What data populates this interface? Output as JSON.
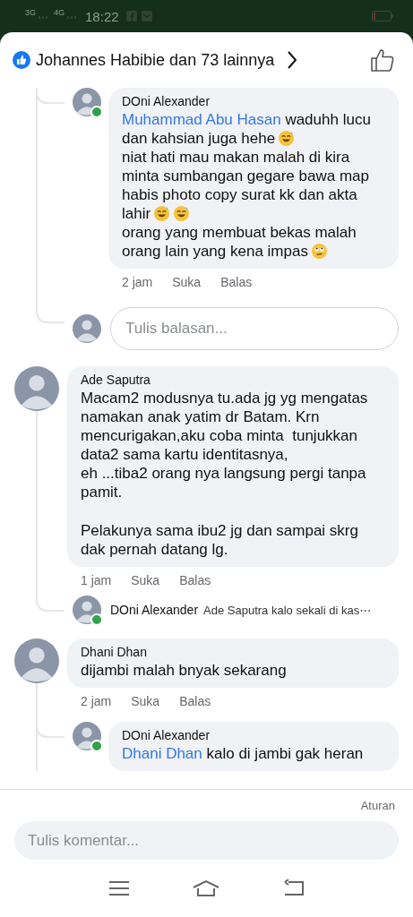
{
  "status_bar": {
    "network_1": "3G",
    "network_2": "4G",
    "time": "18:22"
  },
  "header": {
    "reactions": "Johannes Habibie dan 73 lainnya"
  },
  "comments": [
    {
      "kind": "reply",
      "author": "DOni Alexander",
      "online": true,
      "paragraphs": [
        [
          {
            "mention": "Muhammad Abu Hasan",
            "text": " waduhh lucu"
          },
          {
            "text": "dan kahsian juga hehe",
            "emoji": [
              {
                "kind": "sweat-smile"
              }
            ]
          },
          {
            "text": "niat hati mau makan malah di kira"
          },
          {
            "text": "minta sumbangan gegare bawa map"
          },
          {
            "text": "habis photo copy surat kk dan akta"
          },
          {
            "text": "lahir",
            "emoji": [
              {
                "kind": "sweat-smile"
              },
              {
                "kind": "sweat-smile"
              }
            ]
          },
          {
            "text": "orang yang membuat bekas malah"
          },
          {
            "text": "orang lain yang kena impas",
            "emoji": [
              {
                "kind": "rolling-eyes"
              }
            ]
          }
        ]
      ],
      "time": "2 jam",
      "like": "Suka",
      "reply": "Balas"
    },
    {
      "kind": "reply-input",
      "placeholder": "Tulis balasan..."
    },
    {
      "kind": "comment",
      "author": "Ade Saputra",
      "online": false,
      "paragraphs": [
        [
          {
            "text": "Macam2 modusnya tu.ada jg yg mengatas"
          },
          {
            "text": "namakan anak yatim dr Batam. Krn"
          },
          {
            "text": "mencurigakan,aku coba minta  tunjukkan"
          },
          {
            "text": "data2 sama kartu identitasnya,"
          },
          {
            "text": "eh ...tiba2 orang nya langsung pergi tanpa"
          },
          {
            "text": "pamit."
          }
        ],
        [
          {
            "text": "Pelakunya sama ibu2 jg dan sampai skrg"
          },
          {
            "text": "dak pernah datang lg."
          }
        ]
      ],
      "time": "1 jam",
      "like": "Suka",
      "reply": "Balas"
    },
    {
      "kind": "reply-preview",
      "author": "DOni Alexander",
      "online": true,
      "text": "Ade Saputra kalo sekali di kas⋯"
    },
    {
      "kind": "comment",
      "author": "Dhani Dhan",
      "online": false,
      "paragraphs": [
        [
          {
            "text": "dijambi malah bnyak sekarang"
          }
        ]
      ],
      "time": "2 jam",
      "like": "Suka",
      "reply": "Balas"
    },
    {
      "kind": "reply",
      "author": "DOni Alexander",
      "online": true,
      "paragraphs": [
        [
          {
            "mention": "Dhani Dhan",
            "text": " kalo di jambi gak heran"
          }
        ]
      ]
    }
  ],
  "footer": {
    "rules": "Aturan",
    "placeholder": "Tulis komentar..."
  }
}
